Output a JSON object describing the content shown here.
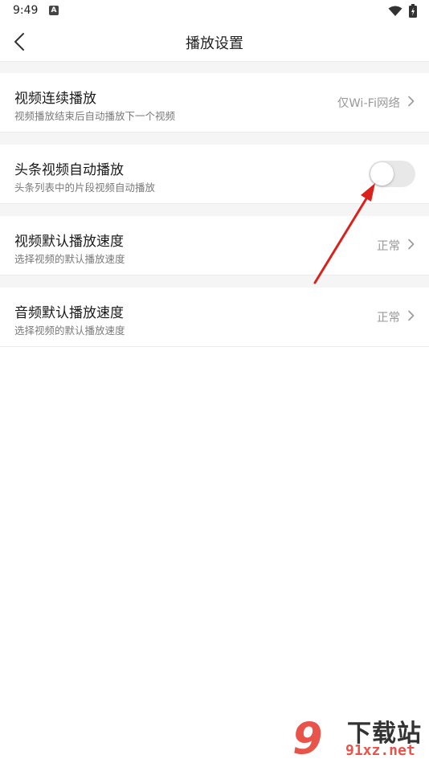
{
  "status_bar": {
    "time": "9:49",
    "notification_icon": "A",
    "icons": [
      "wifi-icon",
      "battery-icon"
    ]
  },
  "header": {
    "title": "播放设置",
    "back_icon": "chevron-left-icon"
  },
  "settings": [
    {
      "title": "视频连续播放",
      "subtitle": "视频播放结束后自动播放下一个视频",
      "value": "仅Wi-Fi网络",
      "control": "chevron"
    },
    {
      "title": "头条视频自动播放",
      "subtitle": "头条列表中的片段视频自动播放",
      "control": "toggle",
      "enabled": false
    },
    {
      "title": "视频默认播放速度",
      "subtitle": "选择视频的默认播放速度",
      "value": "正常",
      "control": "chevron"
    },
    {
      "title": "音频默认播放速度",
      "subtitle": "选择视频的默认播放速度",
      "value": "正常",
      "control": "chevron"
    }
  ],
  "colors": {
    "background": "#ffffff",
    "section_gap": "#f5f5f5",
    "divider": "#ececec",
    "title_text": "#1a1a1a",
    "subtitle_text": "#7a7a7a",
    "value_text": "#9a9a9a",
    "toggle_off": "#e8e8e8",
    "annotation_arrow": "#d9221c"
  },
  "watermark": {
    "logo_digit": "9",
    "site_name": "下载站",
    "url": "91xz.net"
  }
}
